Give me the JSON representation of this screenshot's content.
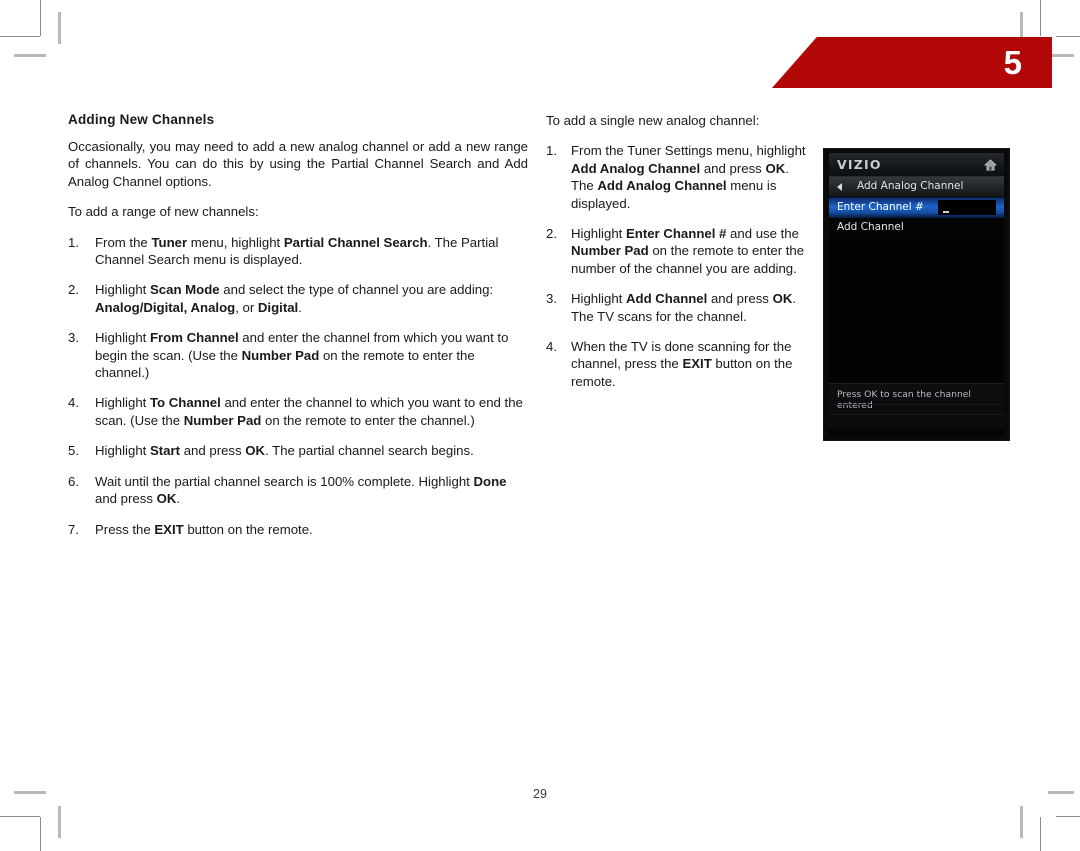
{
  "chapter": {
    "number": "5",
    "banner_color": "#b20808"
  },
  "page_number": "29",
  "left_column": {
    "title": "Adding New Channels",
    "intro": "Occasionally, you may need to add a new analog channel or add a new range of channels. You can do this by using the Partial Channel Search and Add Analog Channel options.",
    "lead_in": "To add a range of new channels:",
    "steps": [
      {
        "num": "1.",
        "parts": [
          {
            "t": "From the ",
            "b": false
          },
          {
            "t": "Tuner",
            "b": true
          },
          {
            "t": " menu, highlight ",
            "b": false
          },
          {
            "t": "Partial Channel Search",
            "b": true
          },
          {
            "t": ". The Partial Channel Search menu is displayed.",
            "b": false
          }
        ]
      },
      {
        "num": "2.",
        "parts": [
          {
            "t": "Highlight ",
            "b": false
          },
          {
            "t": "Scan Mode",
            "b": true
          },
          {
            "t": " and select the type of channel you are adding: ",
            "b": false
          },
          {
            "t": "Analog/Digital, Analog",
            "b": true
          },
          {
            "t": ", or ",
            "b": false
          },
          {
            "t": "Digital",
            "b": true
          },
          {
            "t": ".",
            "b": false
          }
        ]
      },
      {
        "num": "3.",
        "parts": [
          {
            "t": "Highlight ",
            "b": false
          },
          {
            "t": "From Channel",
            "b": true
          },
          {
            "t": " and enter the channel from which you want to begin the scan. (Use the ",
            "b": false
          },
          {
            "t": "Number Pad",
            "b": true
          },
          {
            "t": " on the remote to enter the channel.)",
            "b": false
          }
        ]
      },
      {
        "num": "4.",
        "parts": [
          {
            "t": "Highlight ",
            "b": false
          },
          {
            "t": "To Channel",
            "b": true
          },
          {
            "t": " and enter the channel to which you want to end the scan. (Use the ",
            "b": false
          },
          {
            "t": "Number Pad",
            "b": true
          },
          {
            "t": " on the remote to enter the channel.)",
            "b": false
          }
        ]
      },
      {
        "num": "5.",
        "parts": [
          {
            "t": "Highlight ",
            "b": false
          },
          {
            "t": "Start",
            "b": true
          },
          {
            "t": " and press ",
            "b": false
          },
          {
            "t": "OK",
            "b": true
          },
          {
            "t": ". The partial channel search begins.",
            "b": false
          }
        ]
      },
      {
        "num": "6.",
        "parts": [
          {
            "t": "Wait until the partial channel search is 100% complete. Highlight ",
            "b": false
          },
          {
            "t": "Done",
            "b": true
          },
          {
            "t": " and press ",
            "b": false
          },
          {
            "t": "OK",
            "b": true
          },
          {
            "t": ".",
            "b": false
          }
        ]
      },
      {
        "num": "7.",
        "parts": [
          {
            "t": "Press the ",
            "b": false
          },
          {
            "t": "EXIT",
            "b": true
          },
          {
            "t": " button on the remote.",
            "b": false
          }
        ]
      }
    ]
  },
  "right_column": {
    "lead_in": "To add a single new analog channel:",
    "steps": [
      {
        "num": "1.",
        "parts": [
          {
            "t": "From the Tuner Settings menu, highlight ",
            "b": false
          },
          {
            "t": "Add Analog Channel",
            "b": true
          },
          {
            "t": " and press ",
            "b": false
          },
          {
            "t": "OK",
            "b": true
          },
          {
            "t": ". The ",
            "b": false
          },
          {
            "t": "Add Analog Channel",
            "b": true
          },
          {
            "t": " menu is displayed.",
            "b": false
          }
        ]
      },
      {
        "num": "2.",
        "parts": [
          {
            "t": "Highlight ",
            "b": false
          },
          {
            "t": "Enter Channel #",
            "b": true
          },
          {
            "t": " and use the ",
            "b": false
          },
          {
            "t": "Number Pad",
            "b": true
          },
          {
            "t": " on the remote to enter the number of the channel you are adding.",
            "b": false
          }
        ]
      },
      {
        "num": "3.",
        "parts": [
          {
            "t": "Highlight ",
            "b": false
          },
          {
            "t": "Add Channel",
            "b": true
          },
          {
            "t": " and press ",
            "b": false
          },
          {
            "t": "OK",
            "b": true
          },
          {
            "t": ". The TV scans for the channel.",
            "b": false
          }
        ]
      },
      {
        "num": "4.",
        "parts": [
          {
            "t": "When the TV is done scanning for the channel, press the ",
            "b": false
          },
          {
            "t": "EXIT",
            "b": true
          },
          {
            "t": " button on the remote.",
            "b": false
          }
        ]
      }
    ]
  },
  "tv_screenshot": {
    "brand_logo": "VIZIO",
    "home_icon": "home-icon",
    "back_icon": "back-arrow-icon",
    "menu_title": "Add Analog Channel",
    "rows": [
      {
        "label": "Enter Channel #",
        "selected": true,
        "input_value": ""
      },
      {
        "label": "Add Channel",
        "selected": false
      }
    ],
    "footer_hint": "Press OK to scan the channel entered",
    "highlight_color": "#1d63c8"
  }
}
